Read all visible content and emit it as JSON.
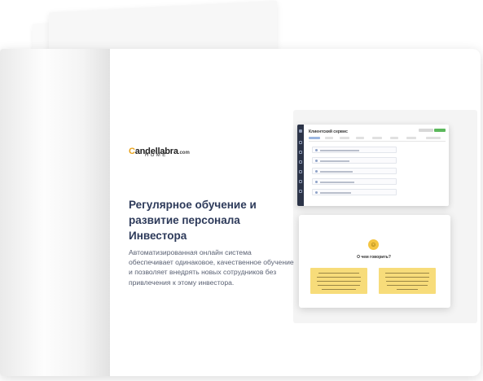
{
  "logo": {
    "brand_prefix": "C",
    "brand_rest": "andellabra",
    "domain_suffix": ".com",
    "tagline": "HOME"
  },
  "headline": "Регулярное обучение и развитие персонала Инвестора",
  "body": "Автоматизированная онлайн система обеспечивает одинаковое, качественное обучение и позволяет внедрять новых сотрудников без привлечения к этому инвестора.",
  "mock": {
    "title": "Клиентский сервис",
    "side_icons": [
      "home-icon",
      "doc-icon",
      "chart-icon",
      "user-icon",
      "list-icon",
      "mail-icon",
      "settings-icon"
    ]
  },
  "chat": {
    "question": "О чем говорить?",
    "emoji": "☺"
  },
  "colors": {
    "headline": "#2d3a5a",
    "accent_yellow": "#f7dc7a",
    "brand_orange": "#e8a21a",
    "sidebar": "#2c3448",
    "green": "#5cb85c"
  }
}
